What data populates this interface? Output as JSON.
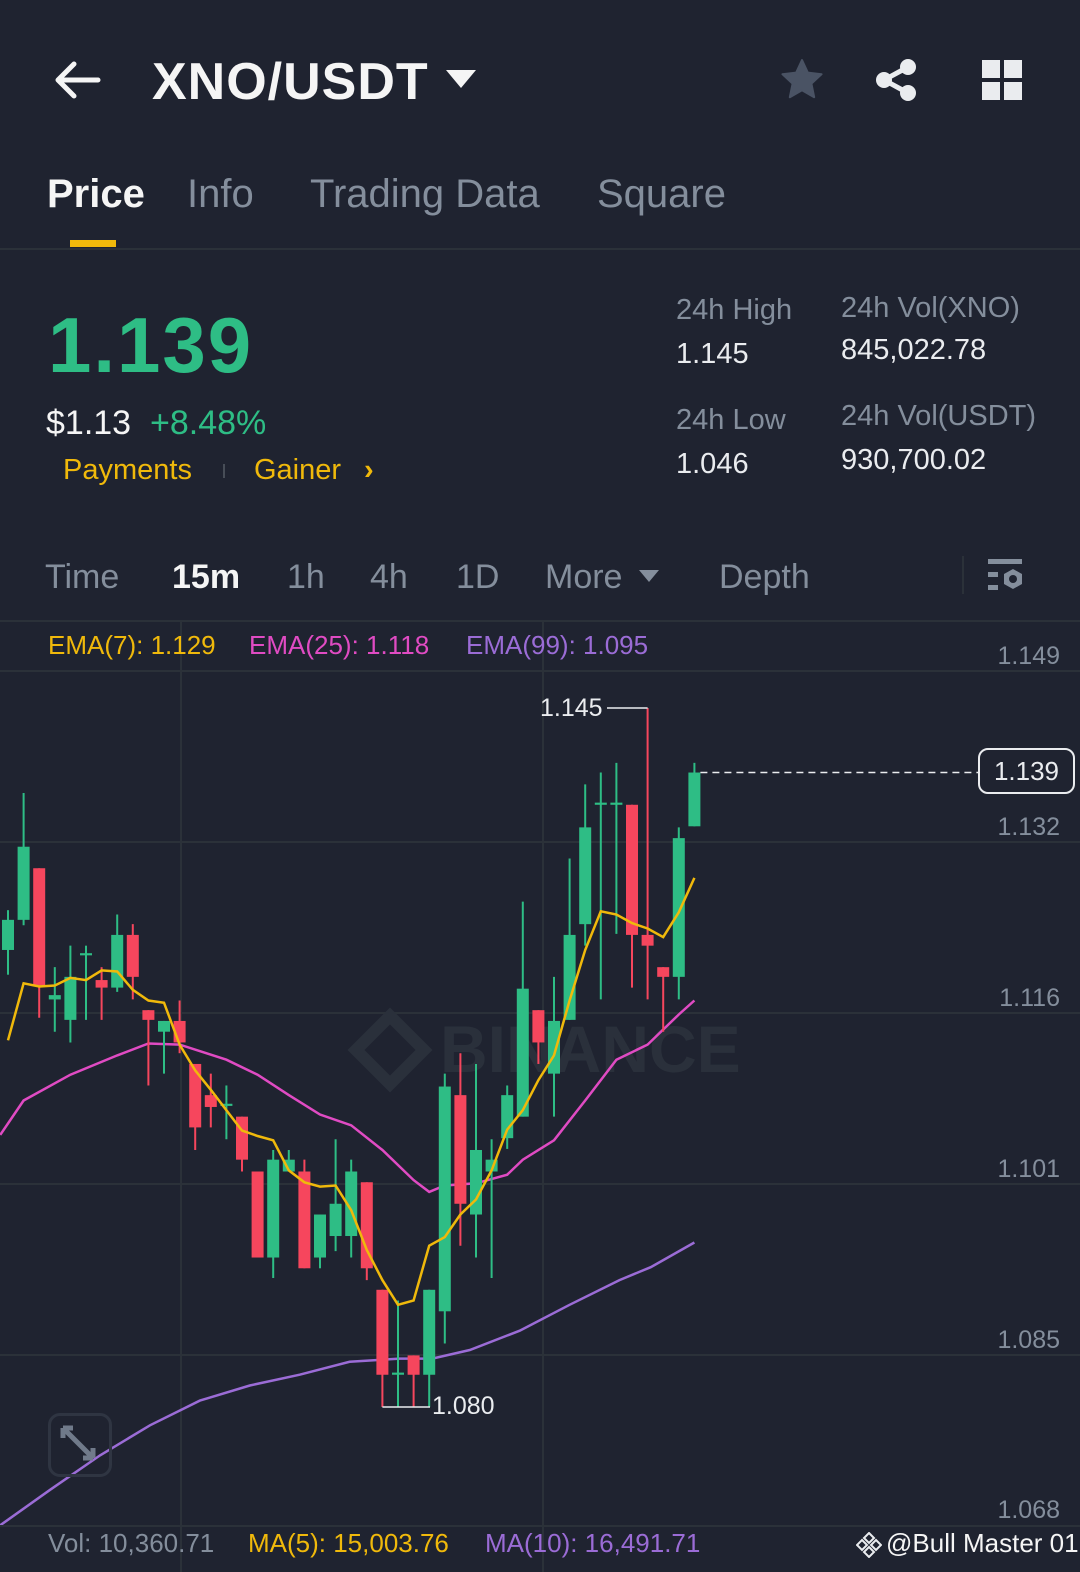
{
  "header": {
    "title": "XNO/USDT",
    "back_icon": "arrow-left-icon",
    "dropdown_icon": "caret-down-icon",
    "icons": [
      "star-icon",
      "share-icon",
      "grid-icon"
    ]
  },
  "tabs": [
    {
      "label": "Price",
      "active": true
    },
    {
      "label": "Info"
    },
    {
      "label": "Trading Data"
    },
    {
      "label": "Square"
    }
  ],
  "ticker": {
    "last_price": "1.139",
    "usd_price": "$1.13",
    "change": "+8.48%",
    "tags": [
      "Payments",
      "Gainer"
    ],
    "stats": {
      "high_label": "24h High",
      "high": "1.145",
      "low_label": "24h Low",
      "low": "1.046",
      "vol_base_label": "24h Vol(XNO)",
      "vol_base": "845,022.78",
      "vol_quote_label": "24h Vol(USDT)",
      "vol_quote": "930,700.02"
    }
  },
  "intervals": [
    {
      "label": "Time"
    },
    {
      "label": "15m",
      "active": true
    },
    {
      "label": "1h"
    },
    {
      "label": "4h"
    },
    {
      "label": "1D"
    },
    {
      "label": "More"
    },
    {
      "label": "Depth"
    }
  ],
  "indicators": {
    "ema7": "EMA(7): 1.129",
    "ema25": "EMA(25): 1.118",
    "ema99": "EMA(99): 1.095"
  },
  "volume": {
    "vol": "Vol: 10,360.71",
    "ma5": "MA(5): 15,003.76",
    "ma10": "MA(10): 16,491.71"
  },
  "watermark": "BINANCE",
  "credit": "@Bull Master 01",
  "colors": {
    "up": "#2ebd85",
    "down": "#f6465d",
    "ema7": "#f0b90b",
    "ema25": "#e04bc3",
    "ema99": "#9b6cd6",
    "bg": "#1f2330"
  },
  "chart_data": {
    "type": "candlestick",
    "interval": "15m",
    "y_ticks": [
      "1.149",
      "1.132",
      "1.116",
      "1.101",
      "1.085",
      "1.068"
    ],
    "last_price_label": "1.139",
    "high_label": "1.145",
    "low_label": "1.080",
    "ohlc": [
      [
        1.1225,
        1.1262,
        1.1202,
        1.1253
      ],
      [
        1.1253,
        1.1371,
        1.1248,
        1.1321
      ],
      [
        1.1301,
        1.1301,
        1.1162,
        1.1192
      ],
      [
        1.1179,
        1.1209,
        1.1149,
        1.1183
      ],
      [
        1.116,
        1.1229,
        1.1139,
        1.12
      ],
      [
        1.122,
        1.1229,
        1.116,
        1.1222
      ],
      [
        1.1197,
        1.1209,
        1.116,
        1.119
      ],
      [
        1.119,
        1.1258,
        1.1186,
        1.1239
      ],
      [
        1.1239,
        1.1249,
        1.1179,
        1.12
      ],
      [
        1.1169,
        1.1169,
        1.1099,
        1.116
      ],
      [
        1.1149,
        1.1159,
        1.111,
        1.1159
      ],
      [
        1.1159,
        1.1178,
        1.1129,
        1.1139
      ],
      [
        1.1119,
        1.1119,
        1.1039,
        1.106
      ],
      [
        1.109,
        1.111,
        1.106,
        1.1079
      ],
      [
        1.108,
        1.1099,
        1.1049,
        1.1082
      ],
      [
        1.107,
        1.107,
        1.1019,
        1.103
      ],
      [
        1.1019,
        1.1019,
        1.0939,
        1.0939
      ],
      [
        1.0939,
        1.1039,
        1.092,
        1.103
      ],
      [
        1.1019,
        1.1039,
        1.1019,
        1.103
      ],
      [
        1.1019,
        1.103,
        1.0929,
        1.0929
      ],
      [
        1.0939,
        1.0979,
        1.0929,
        1.0979
      ],
      [
        1.0959,
        1.1049,
        1.0945,
        1.0989
      ],
      [
        1.0959,
        1.103,
        1.0939,
        1.1019
      ],
      [
        1.1009,
        1.1009,
        1.0918,
        1.0929
      ],
      [
        1.0909,
        1.0909,
        1.08,
        1.083
      ],
      [
        1.083,
        1.0899,
        1.08,
        1.0832
      ],
      [
        1.0848,
        1.0848,
        1.08,
        1.083
      ],
      [
        1.083,
        1.0909,
        1.08,
        1.0909
      ],
      [
        1.0889,
        1.111,
        1.0859,
        1.1098
      ],
      [
        1.109,
        1.1129,
        1.095,
        1.0989
      ],
      [
        1.0979,
        1.1119,
        1.0939,
        1.1039
      ],
      [
        1.1019,
        1.1049,
        1.092,
        1.103
      ],
      [
        1.105,
        1.1099,
        1.104,
        1.109
      ],
      [
        1.107,
        1.127,
        1.107,
        1.1189
      ],
      [
        1.1169,
        1.1169,
        1.1119,
        1.1139
      ],
      [
        1.111,
        1.12,
        1.107,
        1.1159
      ],
      [
        1.116,
        1.131,
        1.116,
        1.1239
      ],
      [
        1.1249,
        1.1379,
        1.1229,
        1.1339
      ],
      [
        1.136,
        1.139,
        1.1179,
        1.1362
      ],
      [
        1.136,
        1.1399,
        1.124,
        1.1362
      ],
      [
        1.136,
        1.136,
        1.119,
        1.1239
      ],
      [
        1.1239,
        1.145,
        1.1179,
        1.1229
      ],
      [
        1.1209,
        1.1209,
        1.1149,
        1.12
      ],
      [
        1.12,
        1.1339,
        1.1179,
        1.1329
      ],
      [
        1.134,
        1.1399,
        1.134,
        1.139
      ]
    ],
    "ema7": [
      1.1141,
      1.1194,
      1.1191,
      1.1192,
      1.1199,
      1.1197,
      1.1206,
      1.1205,
      1.1188,
      1.1178,
      1.1176,
      1.1137,
      1.1113,
      1.1095,
      1.1076,
      1.1057,
      1.1052,
      1.1048,
      1.102,
      1.1009,
      1.1005,
      1.1006,
      1.0983,
      1.0946,
      1.0918,
      1.0895,
      1.0899,
      1.095,
      1.0958,
      1.0979,
      1.0993,
      1.102,
      1.1058,
      1.1076,
      1.1104,
      1.1127,
      1.1178,
      1.1225,
      1.1261,
      1.1258,
      1.125,
      1.1245,
      1.1237,
      1.126,
      1.1292
    ],
    "ema25": [
      [
        0.5,
        1.1053
      ],
      [
        2,
        1.1085
      ],
      [
        5,
        1.1109
      ],
      [
        8,
        1.1127
      ],
      [
        10,
        1.1138
      ],
      [
        12,
        1.1137
      ],
      [
        15,
        1.1123
      ],
      [
        17,
        1.1109
      ],
      [
        19,
        1.109
      ],
      [
        21,
        1.1072
      ],
      [
        23,
        1.1062
      ],
      [
        25,
        1.1039
      ],
      [
        27,
        1.1011
      ],
      [
        28,
        1.1
      ],
      [
        29,
        1.1006
      ],
      [
        31,
        1.1008
      ],
      [
        33,
        1.1016
      ],
      [
        34,
        1.103
      ],
      [
        36,
        1.1048
      ],
      [
        38,
        1.1085
      ],
      [
        40,
        1.1123
      ],
      [
        42,
        1.1137
      ],
      [
        44,
        1.1165
      ],
      [
        45,
        1.1178
      ]
    ],
    "ema99": [
      [
        0.5,
        1.069
      ],
      [
        3.7,
        1.0723
      ],
      [
        6.9,
        1.0755
      ],
      [
        10.1,
        1.0783
      ],
      [
        13.3,
        1.0806
      ],
      [
        16.5,
        1.082
      ],
      [
        19.7,
        1.083
      ],
      [
        22.9,
        1.0842
      ],
      [
        26.1,
        1.0845
      ],
      [
        28.2,
        1.0845
      ],
      [
        30.6,
        1.0853
      ],
      [
        33.8,
        1.0871
      ],
      [
        37,
        1.0895
      ],
      [
        40.2,
        1.0918
      ],
      [
        42.2,
        1.093
      ],
      [
        45,
        1.0953
      ]
    ]
  }
}
